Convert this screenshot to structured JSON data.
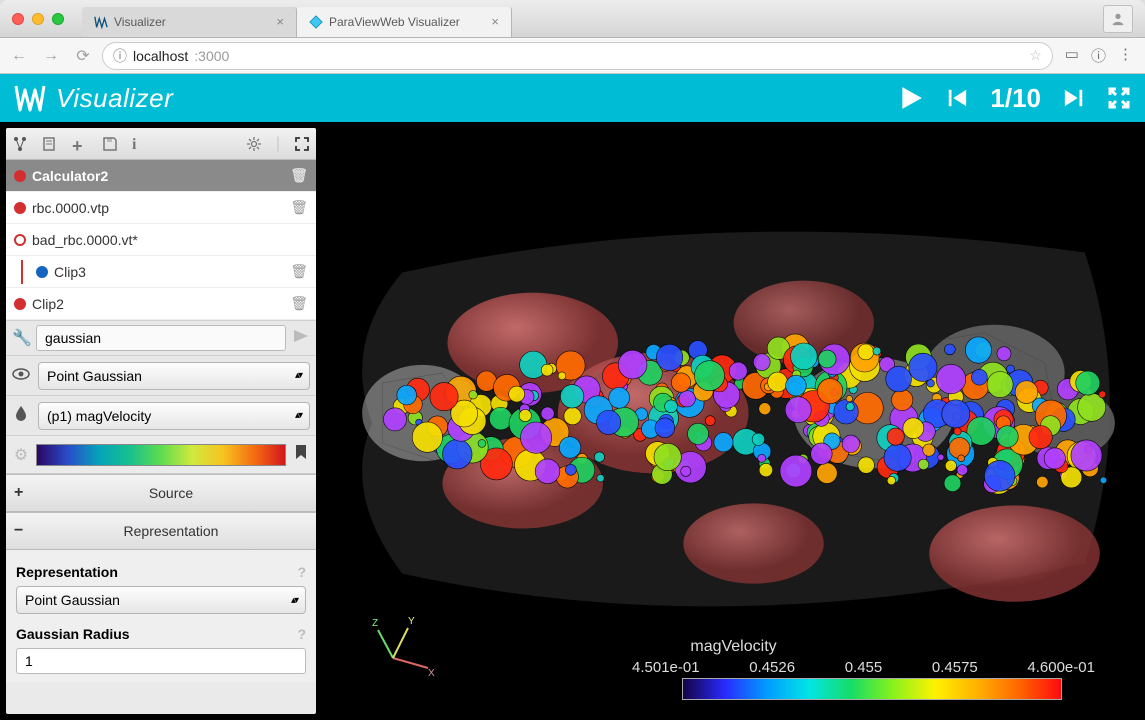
{
  "browser": {
    "tabs": [
      {
        "title": "Visualizer",
        "active": false
      },
      {
        "title": "ParaViewWeb Visualizer",
        "active": true
      }
    ],
    "url_host": "localhost",
    "url_port": ":3000"
  },
  "app": {
    "title": "Visualizer",
    "frame_counter": "1/10"
  },
  "pipeline": {
    "items": [
      {
        "label": "Calculator2",
        "selected": true,
        "dot": "solid-red",
        "indent": 0
      },
      {
        "label": "rbc.0000.vtp",
        "selected": false,
        "dot": "solid-red",
        "indent": 0
      },
      {
        "label": "bad_rbc.0000.vt*",
        "selected": false,
        "dot": "hollow-red",
        "indent": 0
      },
      {
        "label": "Clip3",
        "selected": false,
        "dot": "solid-blue",
        "indent": 1
      },
      {
        "label": "Clip2",
        "selected": false,
        "dot": "solid-red",
        "indent": 0
      }
    ]
  },
  "filter": {
    "value": "gaussian"
  },
  "view_mode": {
    "value": "Point Gaussian"
  },
  "color_array": {
    "value": "(p1) magVelocity"
  },
  "sections": {
    "source": {
      "icon": "+",
      "label": "Source",
      "expanded": false
    },
    "representation": {
      "icon": "−",
      "label": "Representation",
      "expanded": true
    }
  },
  "properties": {
    "representation_label": "Representation",
    "representation_value": "Point Gaussian",
    "gaussian_radius_label": "Gaussian Radius",
    "gaussian_radius_value": "1"
  },
  "color_legend": {
    "title": "magVelocity",
    "ticks": [
      "4.501e-01",
      "0.4526",
      "0.455",
      "0.4575",
      "4.600e-01"
    ]
  },
  "axes": {
    "x": "X",
    "y": "Y",
    "z": "Z"
  }
}
